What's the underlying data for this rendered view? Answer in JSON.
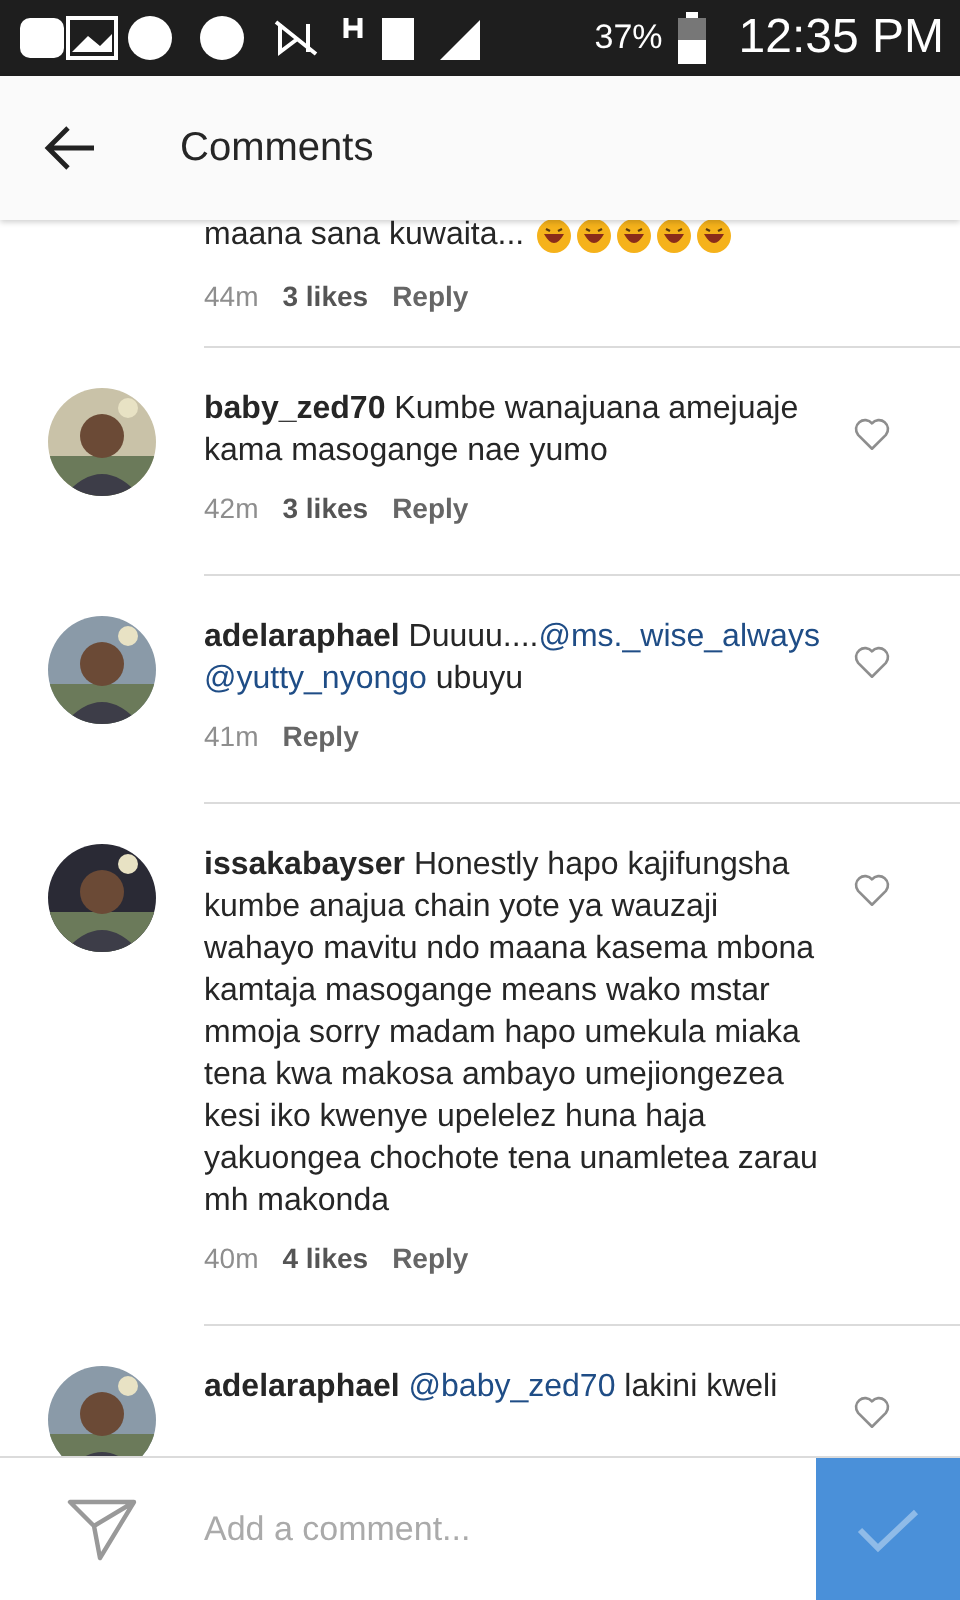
{
  "status_bar": {
    "battery": "37%",
    "time": "12:35 PM"
  },
  "header": {
    "title": "Comments"
  },
  "top_fragment": {
    "text": "maana sana kuwaita...",
    "time": "44m",
    "likes": "3 likes",
    "reply": "Reply"
  },
  "comments": [
    {
      "user": "baby_zed70",
      "parts": [
        {
          "kind": "plain",
          "text": "Kumbe wanajuana amejuaje kama masogange nae yumo"
        }
      ],
      "time": "42m",
      "likes": "3 likes",
      "reply": "Reply",
      "liked": false
    },
    {
      "user": "adelaraphael",
      "parts": [
        {
          "kind": "plain",
          "text": "Duuuu...."
        },
        {
          "kind": "mention",
          "text": "@ms._wise_always"
        },
        {
          "kind": "mention",
          "text": "@yutty_nyongo",
          "space_before": true
        },
        {
          "kind": "plain",
          "text": "ubuyu",
          "space_before": true
        }
      ],
      "time": "41m",
      "reply": "Reply",
      "liked": false
    },
    {
      "user": "issakabayser",
      "parts": [
        {
          "kind": "plain",
          "text": "Honestly hapo kajifungsha kumbe anajua chain yote ya wauzaji wahayo mavitu ndo maana kasema mbona kamtaja masogange means wako mstar mmoja sorry madam hapo umekula miaka tena kwa makosa ambayo umejiongezea kesi iko kwenye upelelez huna haja yakuongea chochote tena unamletea zarau mh makonda"
        }
      ],
      "time": "40m",
      "likes": "4 likes",
      "reply": "Reply",
      "liked": false
    },
    {
      "user": "adelaraphael",
      "parts": [
        {
          "kind": "mention",
          "text": "@baby_zed70"
        },
        {
          "kind": "plain",
          "text": "lakini kweli",
          "space_before": true
        }
      ],
      "liked": false
    }
  ],
  "composer": {
    "placeholder": "Add a comment..."
  }
}
